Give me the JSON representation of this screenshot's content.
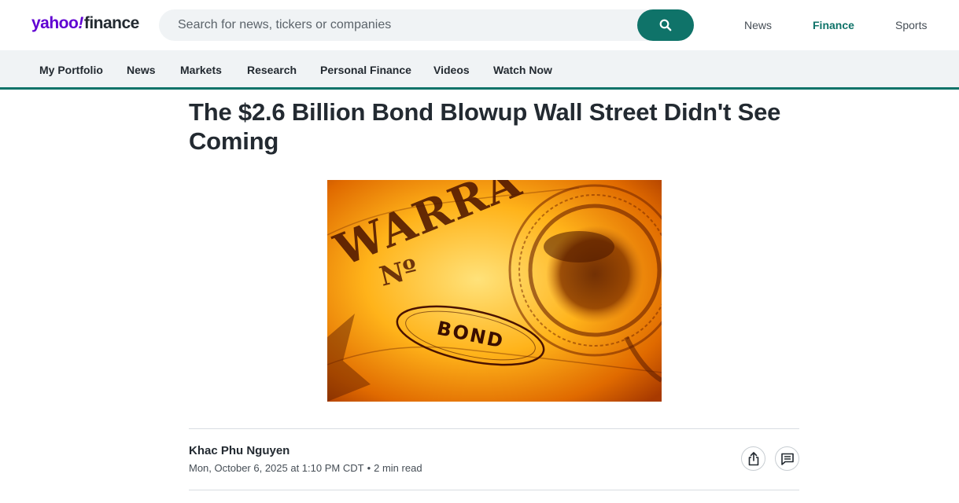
{
  "header": {
    "logo_yahoo": "yahoo",
    "logo_bang": "!",
    "logo_finance": "finance",
    "search_placeholder": "Search for news, tickers or companies",
    "links": [
      {
        "label": "News",
        "active": false
      },
      {
        "label": "Finance",
        "active": true
      },
      {
        "label": "Sports",
        "active": false
      }
    ]
  },
  "nav": {
    "items": [
      "My Portfolio",
      "News",
      "Markets",
      "Research",
      "Personal Finance",
      "Videos",
      "Watch Now"
    ]
  },
  "article": {
    "headline": "The $2.6 Billion Bond Blowup Wall Street Didn't See Coming",
    "image_text_top": "WARRA",
    "image_text_no": "Nº",
    "image_text_bond": "BOND",
    "author": "Khac Phu Nguyen",
    "date": "Mon, October 6, 2025 at 1:10 PM CDT",
    "separator": "•",
    "read_time": "2 min read"
  },
  "colors": {
    "brand_purple": "#6001d2",
    "accent_green": "#0f7369",
    "nav_bg": "#f0f3f5"
  },
  "icons": [
    "search-icon",
    "share-icon",
    "comment-icon"
  ]
}
